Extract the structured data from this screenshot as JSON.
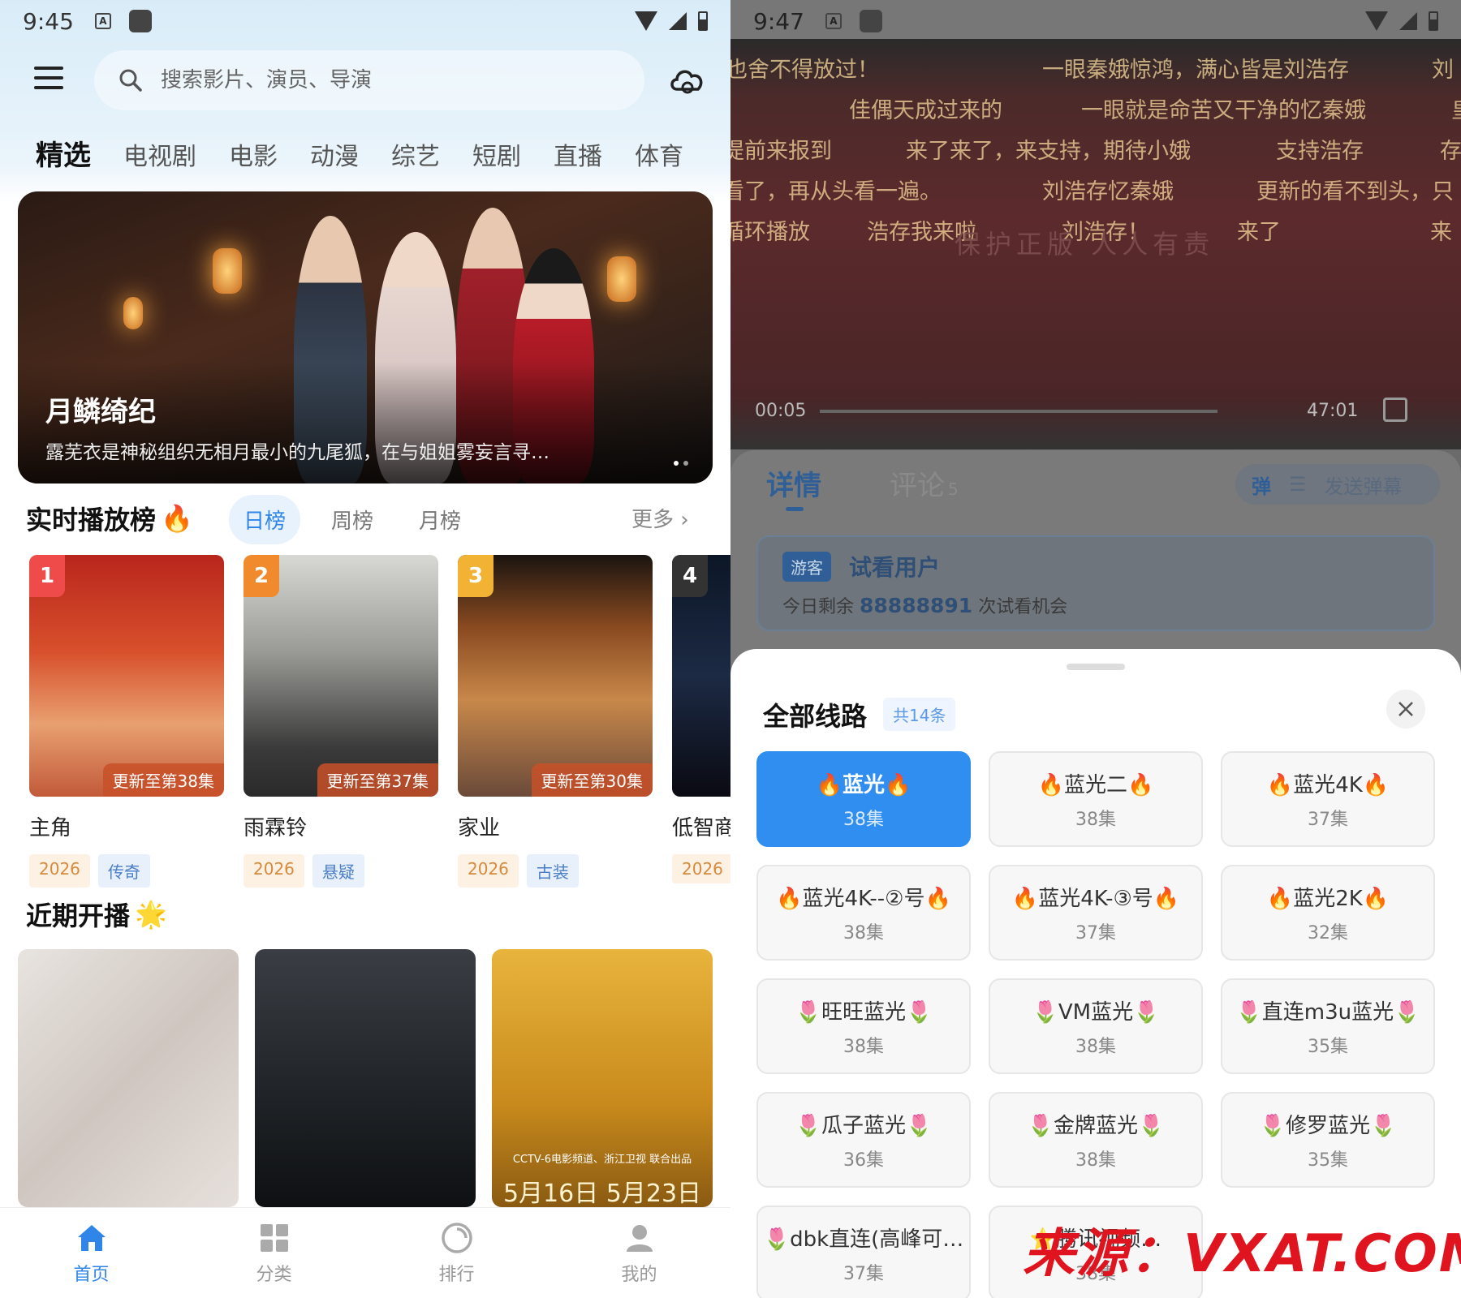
{
  "colors": {
    "accent": "#2f86e8",
    "rank1": "#ef4b4b",
    "rank2": "#f08a2c",
    "rank3": "#f2b233",
    "rank4": "#333333",
    "watermark": "#e0141e"
  },
  "left": {
    "status": {
      "time": "9:45",
      "badge": "A"
    },
    "search": {
      "placeholder": "搜索影片、演员、导演"
    },
    "icons": {
      "menu": "menu-icon",
      "search": "search-icon",
      "cloud": "cloud-icon"
    },
    "categories": [
      "精选",
      "电视剧",
      "电影",
      "动漫",
      "综艺",
      "短剧",
      "直播",
      "体育"
    ],
    "banner": {
      "title": "月鳞绮纪",
      "desc": "露芜衣是神秘组织无相月最小的九尾狐，在与姐姐雾妄言寻…"
    },
    "ranking": {
      "title": "实时播放榜",
      "tabs": [
        "日榜",
        "周榜",
        "月榜"
      ],
      "more": "更多 ›",
      "items": [
        {
          "rank": "1",
          "title": "主角",
          "update": "更新至第38集",
          "year": "2026",
          "genre": "传奇"
        },
        {
          "rank": "2",
          "title": "雨霖铃",
          "update": "更新至第37集",
          "year": "2026",
          "genre": "悬疑"
        },
        {
          "rank": "3",
          "title": "家业",
          "update": "更新至第30集",
          "year": "2026",
          "genre": "古装"
        },
        {
          "rank": "4",
          "title": "低智商",
          "update": "",
          "year": "2026",
          "genre": ""
        }
      ]
    },
    "upcoming": {
      "title": "近期开播",
      "poster3_text": "CCTV-6电影频道、浙江卫视 联合出品",
      "poster3_date": "5月16日 5月23日"
    },
    "nav": [
      {
        "label": "首页",
        "icon": "home-icon"
      },
      {
        "label": "分类",
        "icon": "grid-icon"
      },
      {
        "label": "排行",
        "icon": "ranking-icon"
      },
      {
        "label": "我的",
        "icon": "user-icon"
      }
    ]
  },
  "right": {
    "status": {
      "time": "9:47",
      "badge": "A"
    },
    "danmaku": [
      "也舍不得放过！",
      "一眼秦娥惊鸿，满心皆是刘浩存",
      "刘",
      "佳偶天成过来的",
      "一眼就是命苦又干净的忆秦娥",
      "皇",
      "提前来报到",
      "来了来了，来支持，期待小娥",
      "支持浩存",
      "存",
      "看了，再从头看一遍。",
      "刘浩存忆秦娥",
      "更新的看不到头，只",
      "循环播放",
      "浩存我来啦",
      "刘浩存！",
      "来了",
      "来"
    ],
    "video_watermark": "保护正版  人人有责",
    "player": {
      "current": "00:05",
      "total": "47:01"
    },
    "tabs": {
      "details": "详情",
      "comments": "评论",
      "comment_count": "5"
    },
    "danmaku_btn": "弹",
    "send_danmaku": "发送弹幕",
    "trial": {
      "badge": "游客",
      "user": "试看用户",
      "prefix": "今日剩余",
      "count": "88888891",
      "suffix": "次试看机会"
    },
    "sheet": {
      "title": "全部线路",
      "count": "共14条",
      "lines": [
        {
          "name": "🔥蓝光🔥",
          "eps": "38集",
          "active": true
        },
        {
          "name": "🔥蓝光二🔥",
          "eps": "38集"
        },
        {
          "name": "🔥蓝光4K🔥",
          "eps": "37集"
        },
        {
          "name": "🔥蓝光4K--②号🔥",
          "eps": "38集"
        },
        {
          "name": "🔥蓝光4K-③号🔥",
          "eps": "37集"
        },
        {
          "name": "🔥蓝光2K🔥",
          "eps": "32集"
        },
        {
          "name": "🌷旺旺蓝光🌷",
          "eps": "38集"
        },
        {
          "name": "🌷VM蓝光🌷",
          "eps": "38集"
        },
        {
          "name": "🌷直连m3u蓝光🌷",
          "eps": "35集"
        },
        {
          "name": "🌷瓜子蓝光🌷",
          "eps": "36集"
        },
        {
          "name": "🌷金牌蓝光🌷",
          "eps": "38集"
        },
        {
          "name": "🌷修罗蓝光🌷",
          "eps": "35集"
        },
        {
          "name": "🌷dbk直连(高峰可…",
          "eps": "37集"
        },
        {
          "name": "⭐腾讯视频…",
          "eps": "38集"
        }
      ]
    },
    "watermark": "来源：VXAT.COM"
  }
}
